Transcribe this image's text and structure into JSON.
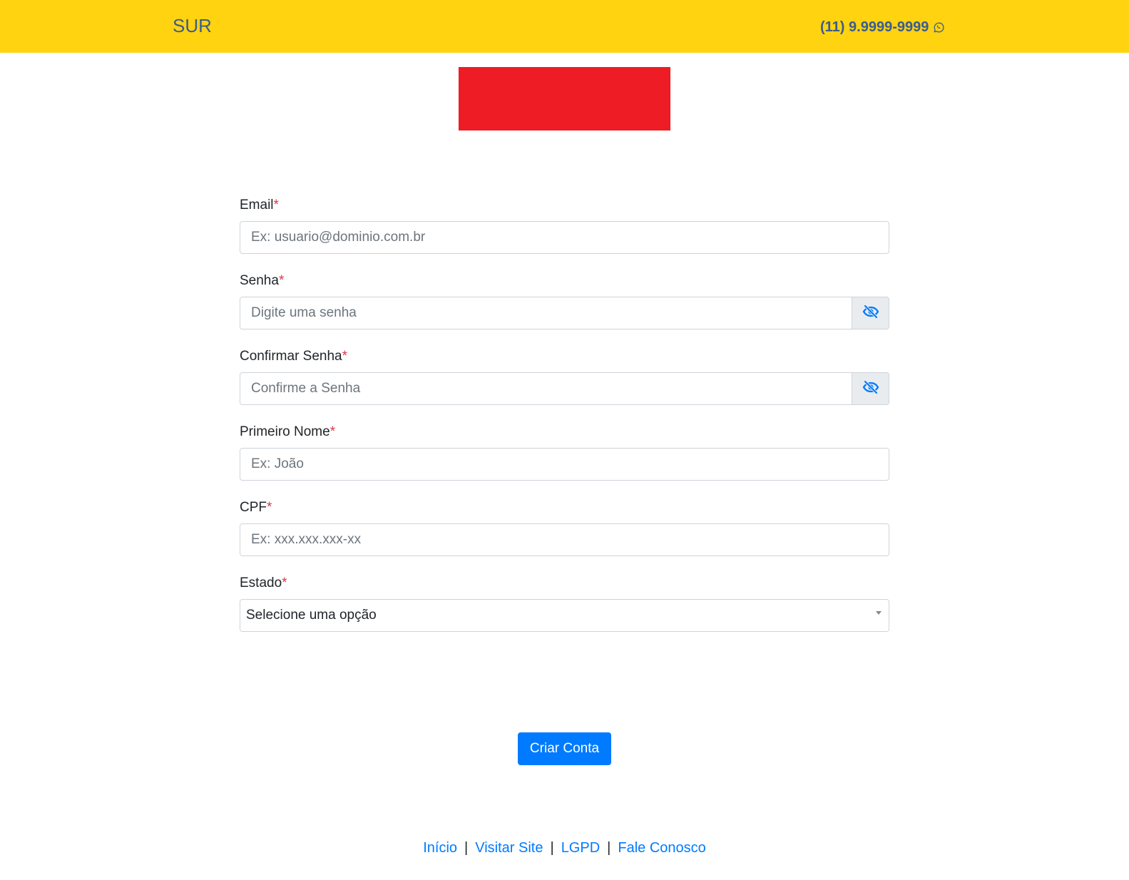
{
  "header": {
    "brand": "SUR",
    "phone": "(11) 9.9999-9999",
    "phone_icon": "whatsapp-icon",
    "background_color": "#ffd310",
    "text_color": "#3b5c8f"
  },
  "logo": {
    "color": "#ee1c25"
  },
  "form": {
    "required_mark": "*",
    "email": {
      "label": "Email",
      "placeholder": "Ex: usuario@dominio.com.br",
      "value": ""
    },
    "password": {
      "label": "Senha",
      "placeholder": "Digite uma senha",
      "value": "",
      "toggle_icon": "eye-slash-icon"
    },
    "confirm_password": {
      "label": "Confirmar Senha",
      "placeholder": "Confirme a Senha",
      "value": "",
      "toggle_icon": "eye-slash-icon"
    },
    "first_name": {
      "label": "Primeiro Nome",
      "placeholder": "Ex: João",
      "value": ""
    },
    "cpf": {
      "label": "CPF",
      "placeholder": "Ex: xxx.xxx.xxx-xx",
      "value": ""
    },
    "state": {
      "label": "Estado",
      "selected": "Selecione uma opção"
    },
    "submit_label": "Criar Conta",
    "accent_color": "#007bff"
  },
  "footer": {
    "links": [
      "Início",
      "Visitar Site",
      "LGPD",
      "Fale Conosco"
    ],
    "separator": "|"
  }
}
